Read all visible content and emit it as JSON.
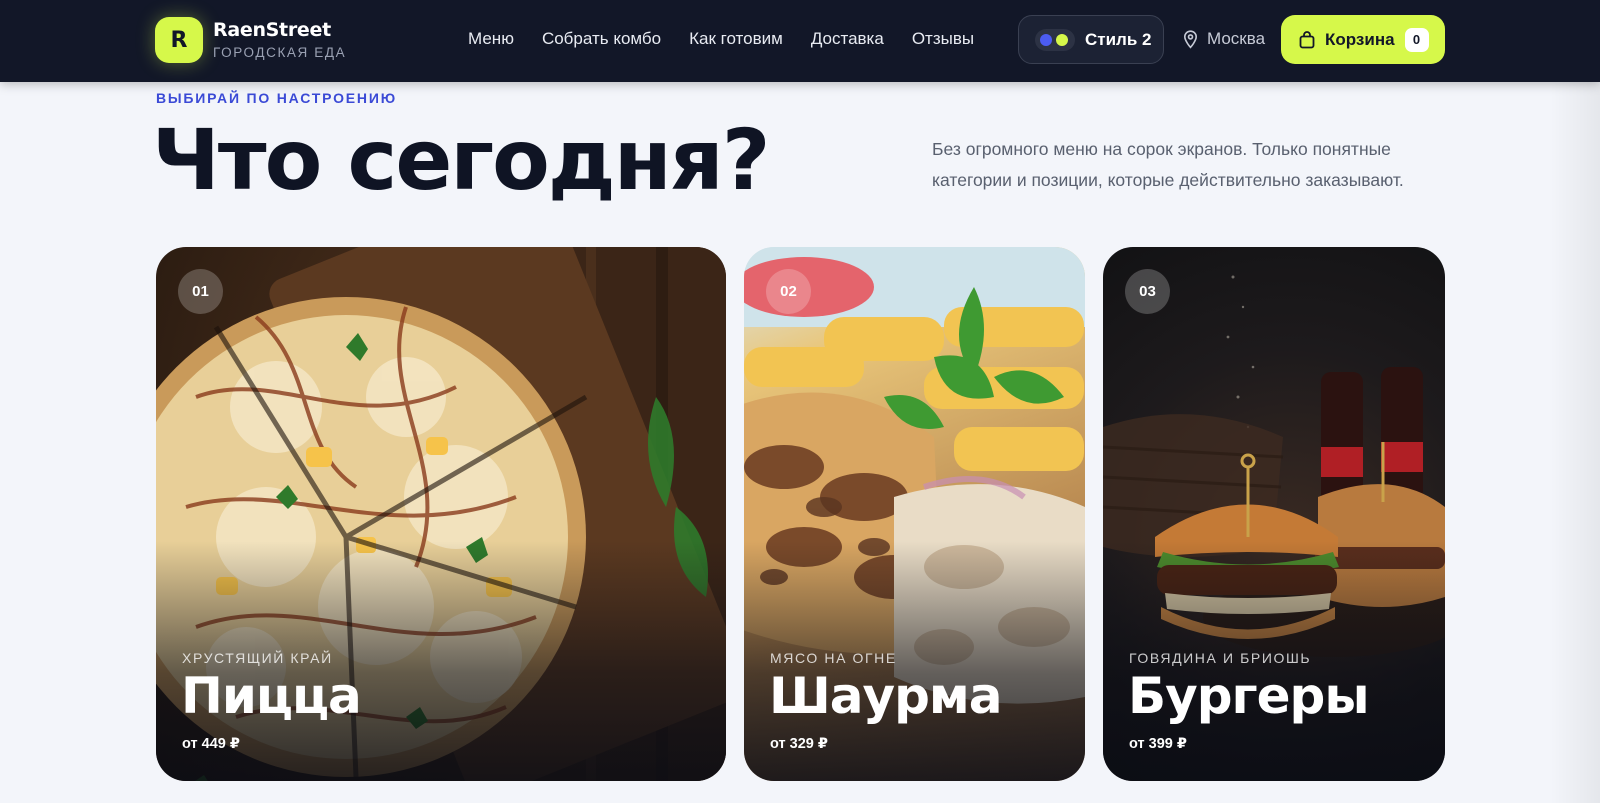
{
  "header": {
    "logo_letter": "R",
    "brand_name": "RaenStreet",
    "brand_sub": "ГОРОДСКАЯ ЕДА",
    "nav": [
      "Меню",
      "Собрать комбо",
      "Как готовим",
      "Доставка",
      "Отзывы"
    ],
    "style_label": "Стиль 2",
    "city": "Москва",
    "cart_label": "Корзина",
    "cart_count": "0"
  },
  "hero": {
    "eyebrow": "ВЫБИРАЙ ПО НАСТРОЕНИЮ",
    "title": "Что сегодня?",
    "intro": "Без огромного меню на сорок экранов. Только понятные категории и позиции, которые действительно заказывают."
  },
  "cards": [
    {
      "num": "01",
      "tag": "ХРУСТЯЩИЙ КРАЙ",
      "name": "Пицца",
      "price": "от 449 ₽"
    },
    {
      "num": "02",
      "tag": "МЯСО НА ОГНЕ",
      "name": "Шаурма",
      "price": "от 329 ₽"
    },
    {
      "num": "03",
      "tag": "ГОВЯДИНА И БРИОШЬ",
      "name": "Бургеры",
      "price": "от 399 ₽"
    }
  ],
  "colors": {
    "accent_lime": "#d6f84a",
    "header_bg": "#121728",
    "eyebrow_blue": "#3b4ad6"
  },
  "icons": [
    "location-pin-icon",
    "shopping-bag-icon"
  ]
}
